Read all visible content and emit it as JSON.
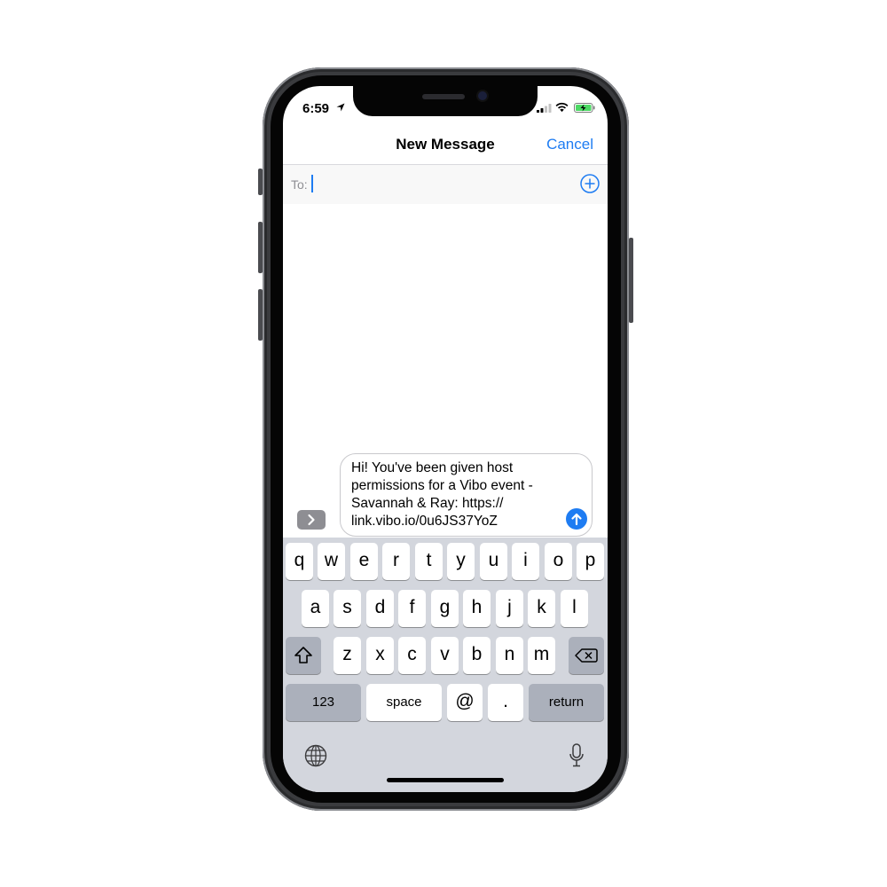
{
  "status": {
    "time": "6:59",
    "icons": [
      "location-arrow-icon",
      "cellular-signal-icon",
      "wifi-icon",
      "battery-charging-icon"
    ]
  },
  "nav": {
    "title": "New Message",
    "cancel_label": "Cancel"
  },
  "recipient": {
    "label": "To:",
    "value": ""
  },
  "compose": {
    "lines": [
      "Hi! You've been given host",
      "permissions for a Vibo event -",
      "Savannah & Ray:  https://",
      "link.vibo.io/0u6JS37YoZ"
    ]
  },
  "keyboard": {
    "row1": [
      "q",
      "w",
      "e",
      "r",
      "t",
      "y",
      "u",
      "i",
      "o",
      "p"
    ],
    "row2": [
      "a",
      "s",
      "d",
      "f",
      "g",
      "h",
      "j",
      "k",
      "l"
    ],
    "row3": [
      "z",
      "x",
      "c",
      "v",
      "b",
      "n",
      "m"
    ],
    "numbers_label": "123",
    "space_label": "space",
    "at_label": "@",
    "period_label": ".",
    "return_label": "return"
  },
  "colors": {
    "accent": "#1e7cf2",
    "keyboard_bg": "#d3d6dd",
    "dark_key": "#abb0bb"
  }
}
